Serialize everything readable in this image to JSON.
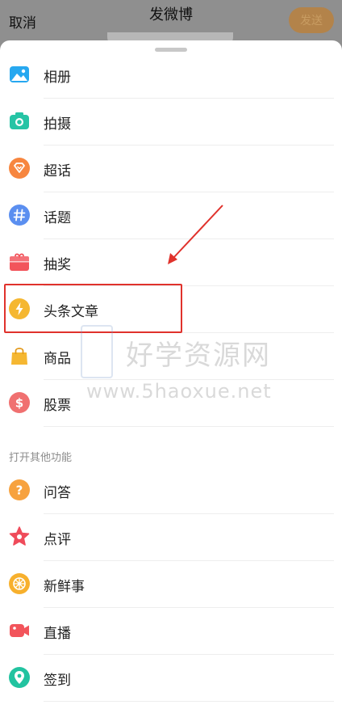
{
  "topbar": {
    "cancel_label": "取消",
    "title": "发微博",
    "send_label": "发送"
  },
  "menu": {
    "items": [
      {
        "label": "相册",
        "icon": "photo-album-icon",
        "color": "#27a8f0"
      },
      {
        "label": "拍摄",
        "icon": "camera-icon",
        "color": "#26c4a5"
      },
      {
        "label": "超话",
        "icon": "super-topic-icon",
        "color": "#f7863f"
      },
      {
        "label": "话题",
        "icon": "hashtag-icon",
        "color": "#5b8ff0"
      },
      {
        "label": "抽奖",
        "icon": "gift-icon",
        "color": "#f2545b"
      },
      {
        "label": "头条文章",
        "icon": "lightning-icon",
        "color": "#f5b731"
      },
      {
        "label": "商品",
        "icon": "shopping-bag-icon",
        "color": "#f5b731"
      },
      {
        "label": "股票",
        "icon": "dollar-icon",
        "color": "#f07070"
      }
    ],
    "highlighted_item": "头条文章"
  },
  "other_section": {
    "title": "打开其他功能",
    "items": [
      {
        "label": "问答",
        "icon": "question-icon",
        "color": "#f7a23f"
      },
      {
        "label": "点评",
        "icon": "star-icon",
        "color": "#ef4b5a"
      },
      {
        "label": "新鲜事",
        "icon": "orange-slice-icon",
        "color": "#f7b02d"
      },
      {
        "label": "直播",
        "icon": "video-camera-icon",
        "color": "#f2545b"
      },
      {
        "label": "签到",
        "icon": "location-pin-icon",
        "color": "#22c3a0"
      }
    ]
  },
  "watermark": {
    "text_cn": "好学资源网",
    "text_url": "www.5haoxue.net"
  },
  "annotation_color": "#e0322c"
}
